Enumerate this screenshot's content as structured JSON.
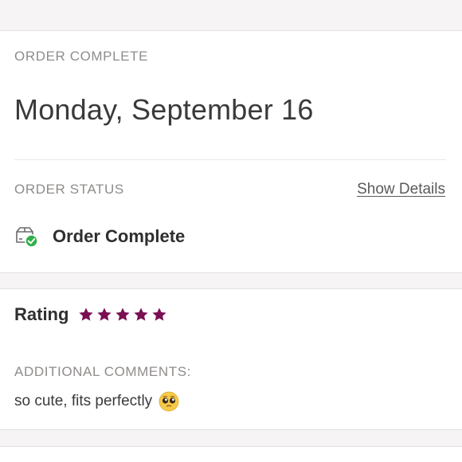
{
  "order": {
    "section_label": "ORDER COMPLETE",
    "date": "Monday, September 16"
  },
  "status": {
    "section_label": "ORDER STATUS",
    "show_details_label": "Show Details",
    "status_text": "Order Complete",
    "icon": "package-check-icon",
    "check_color": "#2fb04a"
  },
  "rating": {
    "label": "Rating",
    "stars": 5,
    "max_stars": 5,
    "star_color": "#7a0f52"
  },
  "comments": {
    "section_label": "ADDITIONAL COMMENTS:",
    "text": "so cute, fits perfectly",
    "emoji": "pleading-face-emoji"
  }
}
